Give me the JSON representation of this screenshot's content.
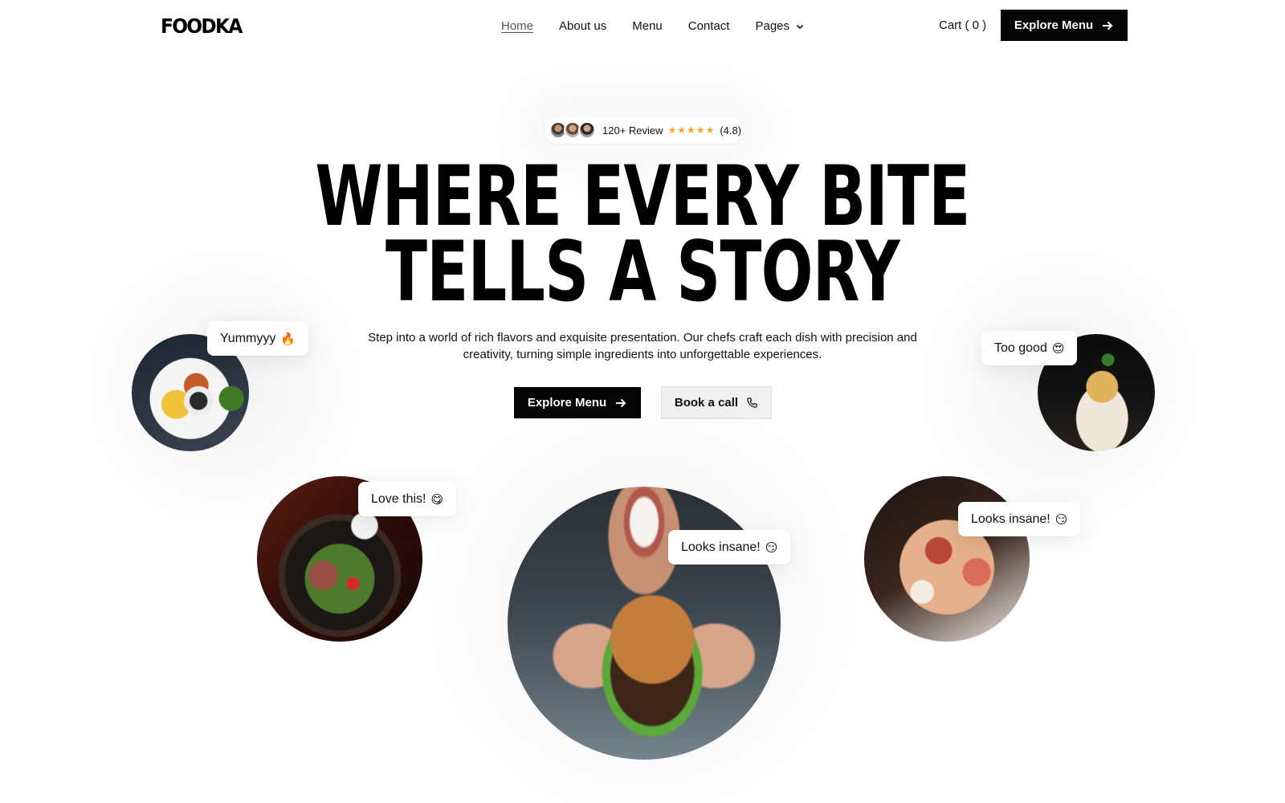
{
  "nav": {
    "logo": "FOODKA",
    "links": [
      "Home",
      "About us",
      "Menu",
      "Contact",
      "Pages"
    ],
    "cart": "Cart ( 0 )",
    "cta": "Explore Menu"
  },
  "badge": {
    "reviews": "120+ Review",
    "stars": "★★★★★",
    "rating": "(4.8)"
  },
  "hero": {
    "title_line1": "WHERE EVERY BITE",
    "title_line2": "TELLS A STORY",
    "subtitle": "Step into a world of rich flavors and exquisite presentation. Our chefs craft each dish with precision and creativity, turning simple ingredients into unforgettable experiences.",
    "primary_button": "Explore Menu",
    "secondary_button": "Book a call"
  },
  "bubbles": [
    {
      "text": "Yummyyy",
      "emoji": "🔥"
    },
    {
      "text": "Too good",
      "emoji": "😍"
    },
    {
      "text": "Love this!",
      "emoji": "😋"
    },
    {
      "text": "Looks insane!",
      "emoji": "😏"
    },
    {
      "text": "Looks insane!",
      "emoji": "😏"
    }
  ],
  "colors": {
    "primary": "#050505",
    "star": "#f5a623",
    "secondary_button_bg": "#f0f0f0"
  },
  "icons": [
    "arrow-right-icon",
    "chevron-down-icon",
    "phone-icon",
    "star-icon"
  ]
}
